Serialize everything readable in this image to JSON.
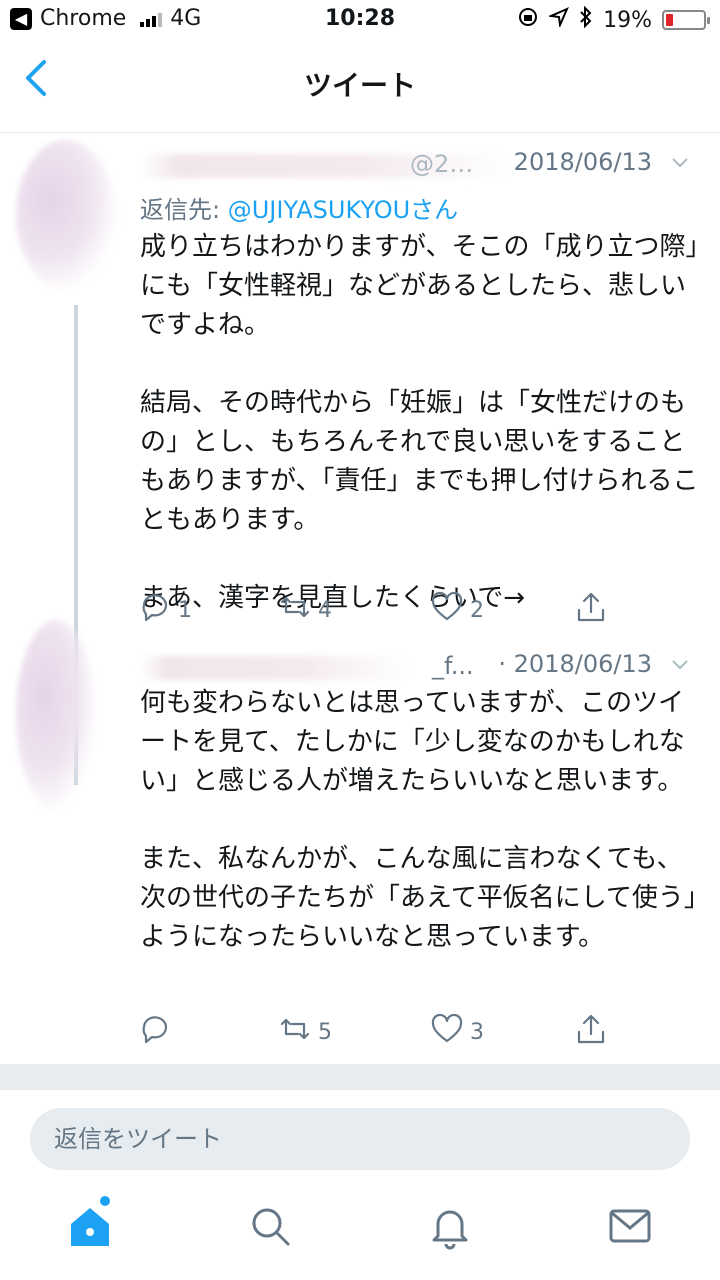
{
  "status_bar": {
    "app": "Chrome",
    "network": "4G",
    "time": "10:28",
    "battery": "19%",
    "battery_level": 0.19
  },
  "header": {
    "title": "ツイート"
  },
  "tweets": [
    {
      "handle": "@2…",
      "date": "2018/06/13",
      "reply_label": "返信先: ",
      "reply_mention": "@UJIYASUKYOUさん",
      "text": "成り立ちはわかりますが、そこの「成り立つ際」にも「女性軽視」などがあるとしたら、悲しいですよね。\n\n結局、その時代から「妊娠」は「女性だけのもの」とし、もちろんそれで良い思いをすることもありますが、「責任」までも押し付けられることもあります。\n\nまあ、漢字を見直したくらいで→",
      "replies": "1",
      "retweets": "4",
      "likes": "2"
    },
    {
      "handle": "_f...",
      "date": "· 2018/06/13",
      "text": "何も変わらないとは思っていますが、このツイートを見て、たしかに「少し変なのかもしれない」と感じる人が増えたらいいなと思います。\n\nまた、私なんかが、こんな風に言わなくても、次の世代の子たちが「あえて平仮名にして使う」ようになったらいいなと思っています。",
      "replies": "",
      "retweets": "5",
      "likes": "3"
    }
  ],
  "reply_box": {
    "placeholder": "返信をツイート"
  },
  "tab_bar": {
    "items": [
      "home-icon",
      "search-icon",
      "notifications-icon",
      "messages-icon"
    ]
  },
  "colors": {
    "accent": "#1da1f2",
    "meta": "#657786",
    "text": "#14171a",
    "band": "#e6ecf0"
  }
}
